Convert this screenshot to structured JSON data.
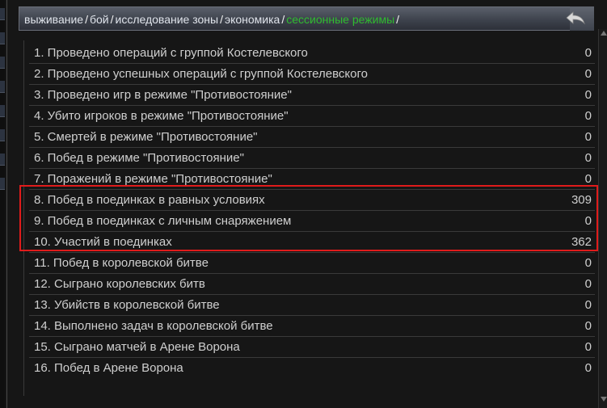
{
  "breadcrumb": {
    "items": [
      "выживание",
      "бой",
      "исследование зоны",
      "экономика",
      "сессионные режимы"
    ],
    "separator": "/",
    "active_index": 4,
    "active_color": "#2fbb2f"
  },
  "back_button": {
    "icon": "back-arrow-icon"
  },
  "stats": [
    {
      "label": "1. Проведено операций с группой Костелевского",
      "value": "0"
    },
    {
      "label": "2. Проведено успешных операций с группой Костелевского",
      "value": "0"
    },
    {
      "label": "3. Проведено игр в режиме \"Противостояние\"",
      "value": "0"
    },
    {
      "label": "4. Убито игроков в режиме \"Противостояние\"",
      "value": "0"
    },
    {
      "label": "5. Смертей в режиме \"Противостояние\"",
      "value": "0"
    },
    {
      "label": "6. Побед в режиме \"Противостояние\"",
      "value": "0"
    },
    {
      "label": "7. Поражений в режиме \"Противостояние\"",
      "value": "0"
    },
    {
      "label": "8. Побед в поединках в равных условиях",
      "value": "309"
    },
    {
      "label": "9. Побед в поединках с личным снаряжением",
      "value": "0"
    },
    {
      "label": "10. Участий в поединках",
      "value": "362"
    },
    {
      "label": "11. Побед в королевской битве",
      "value": "0"
    },
    {
      "label": "12. Сыграно королевских битв",
      "value": "0"
    },
    {
      "label": "13. Убийств в королевской битве",
      "value": "0"
    },
    {
      "label": "14. Выполнено задач в королевской битве",
      "value": "0"
    },
    {
      "label": "15. Сыграно матчей в Арене Ворона",
      "value": "0"
    },
    {
      "label": "16. Побед в Арене Ворона",
      "value": "0"
    }
  ],
  "highlight": {
    "rows": [
      8,
      9,
      10
    ],
    "color": "#e01b1b"
  }
}
